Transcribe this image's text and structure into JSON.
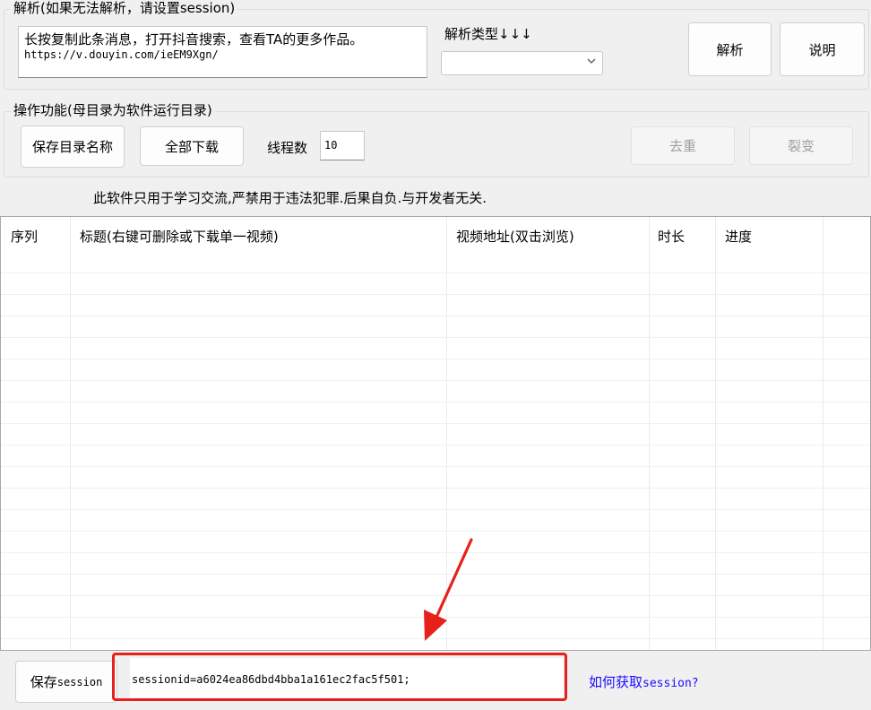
{
  "parse_group": {
    "title": "解析(如果无法解析，请设置session)",
    "url_text_line1": "长按复制此条消息，打开抖音搜索，查看TA的更多作品。",
    "url_text_line2": "https://v.douyin.com/ieEM9Xgn/",
    "type_label": "解析类型↓↓↓",
    "type_value": "",
    "parse_button": "解析",
    "help_button": "说明"
  },
  "ops_group": {
    "title": "操作功能(母目录为软件运行目录)",
    "save_dir_button": "保存目录名称",
    "download_all_button": "全部下载",
    "thread_label": "线程数",
    "thread_value": "10",
    "dedupe_button": "去重",
    "fission_button": "裂变"
  },
  "disclaimer": "此软件只用于学习交流,严禁用于违法犯罪.后果自负.与开发者无关.",
  "table": {
    "columns": [
      "序列",
      "标题(右键可删除或下载单一视频)",
      "视频地址(双击浏览)",
      "时长",
      "进度"
    ],
    "rows": []
  },
  "session": {
    "save_button_prefix": "保存",
    "save_button_suffix": "session",
    "value": "sessionid=a6024ea86dbd4bba1a161ec2fac5f501;",
    "help_link_prefix": "如何获取",
    "help_link_suffix": "session?"
  },
  "colors": {
    "highlight": "#e6201a",
    "link": "#1a0dff"
  }
}
